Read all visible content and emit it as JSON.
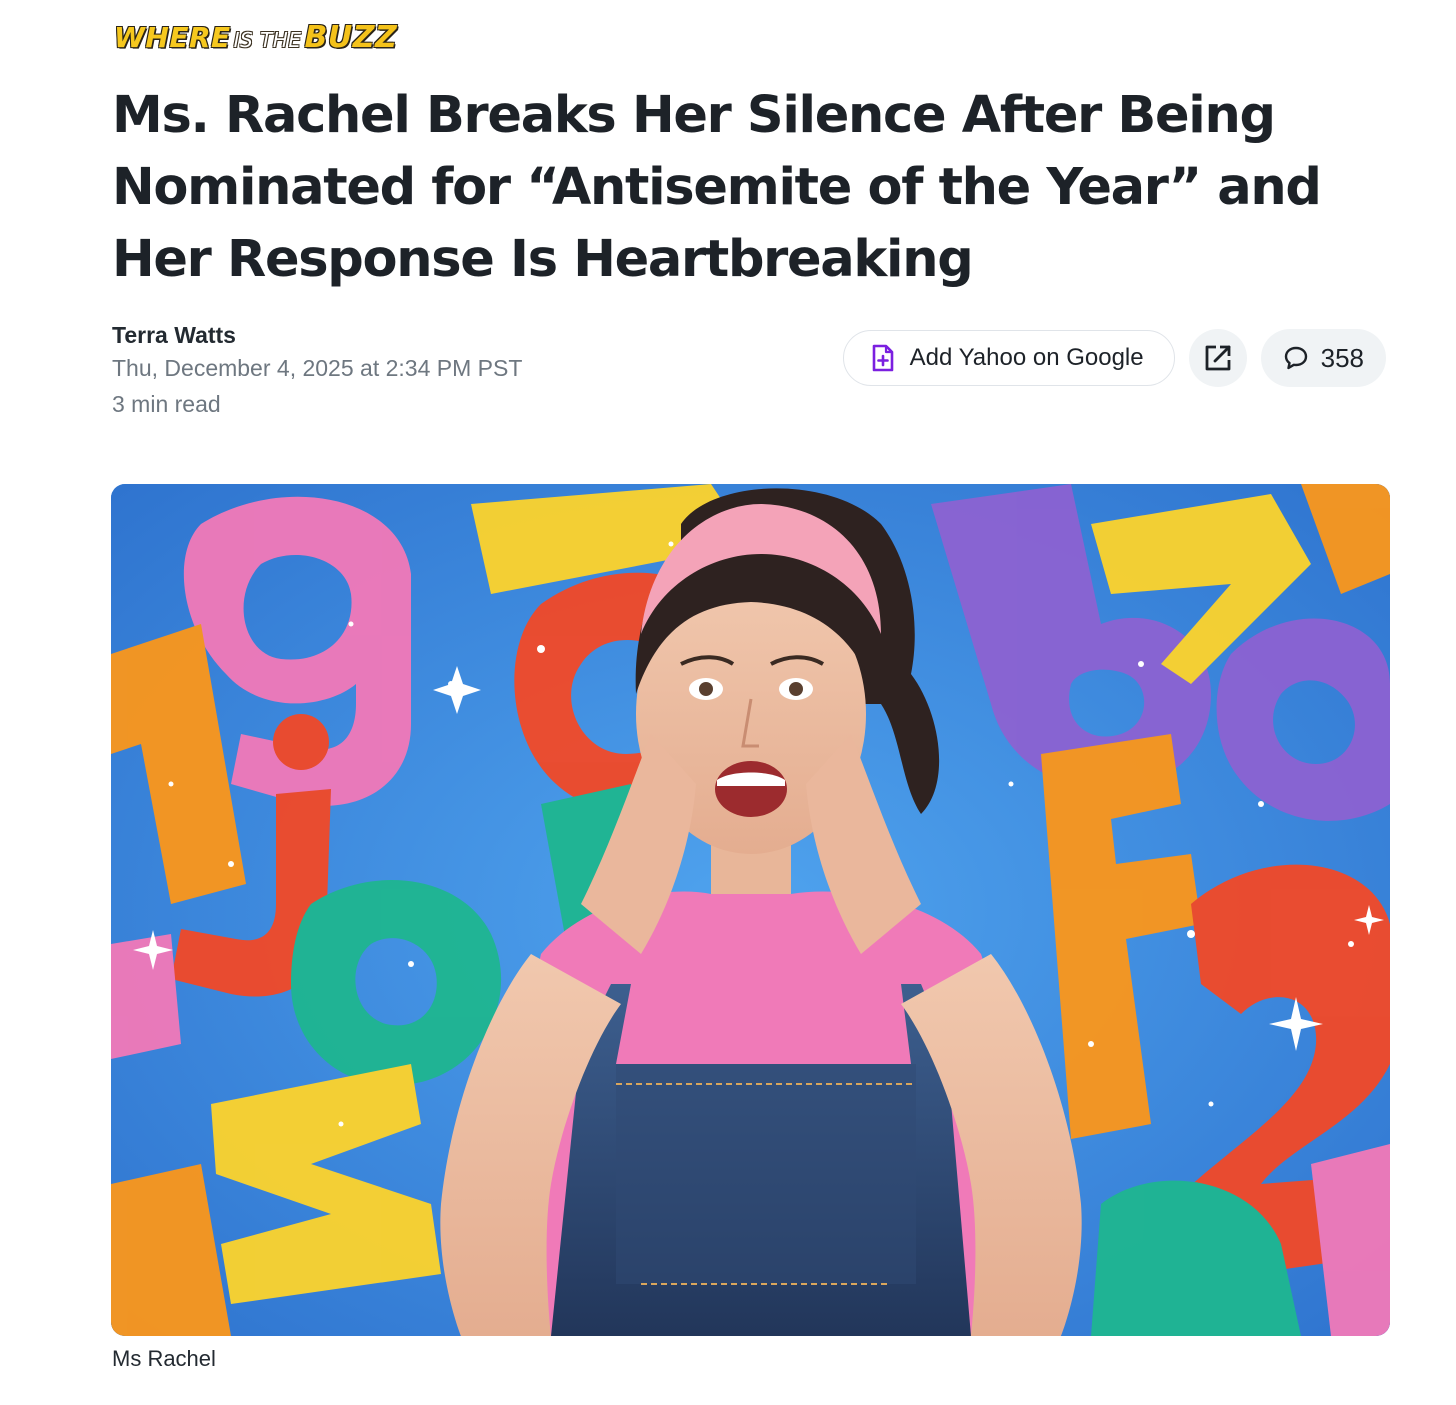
{
  "logo": {
    "word1": "WHERE",
    "word2": "IS THE",
    "word3": "BUZZ"
  },
  "article": {
    "title": "Ms. Rachel Breaks Her Silence After Being Nominated for “Antisemite of the Year” and Her Response Is Heartbreaking",
    "author": "Terra Watts",
    "date": "Thu, December 4, 2025 at 2:34 PM PST",
    "read_time": "3 min read"
  },
  "actions": {
    "add_google_label": "Add Yahoo on Google",
    "comment_count": "358"
  },
  "hero": {
    "caption": "Ms Rachel"
  },
  "colors": {
    "accent_purple": "#7b1fe0",
    "text_primary": "#1d2228",
    "text_muted": "#6e7780",
    "button_bg": "#f0f3f5"
  },
  "icons": {
    "add_google": "document-plus-icon",
    "share": "external-link-icon",
    "comments": "speech-bubble-icon"
  }
}
